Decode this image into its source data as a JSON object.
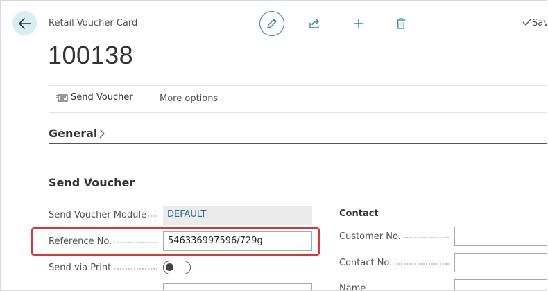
{
  "header": {
    "card_type": "Retail Voucher Card",
    "record_no": "100138",
    "saved_label": "Saved"
  },
  "actions": {
    "send_voucher": "Send Voucher",
    "more_options": "More options"
  },
  "sections": {
    "general": "General",
    "send_voucher": "Send Voucher",
    "contact": "Contact"
  },
  "fields": {
    "send_voucher_module": {
      "label": "Send Voucher Module",
      "value": "DEFAULT"
    },
    "reference_no": {
      "label": "Reference No.",
      "value": "546336997596/729g"
    },
    "send_via_print": {
      "label": "Send via Print",
      "value": false
    },
    "customer_no": {
      "label": "Customer No.",
      "value": ""
    },
    "contact_no": {
      "label": "Contact No.",
      "value": ""
    },
    "name": {
      "label": "Name",
      "value": ""
    }
  },
  "colors": {
    "accent": "#2c8a8a",
    "highlight": "#d9383a"
  },
  "icons": [
    "back-arrow-icon",
    "pencil-icon",
    "share-icon",
    "plus-icon",
    "trash-icon",
    "checkmark-icon",
    "voucher-icon",
    "chevron-right-icon"
  ]
}
